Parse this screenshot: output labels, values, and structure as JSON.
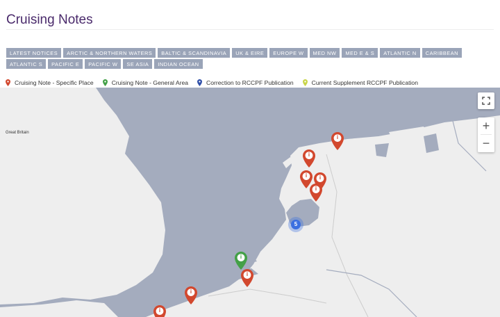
{
  "page": {
    "title": "Cruising Notes"
  },
  "tabs": [
    "LATEST NOTICES",
    "ARCTIC & NORTHERN WATERS",
    "BALTIC & SCANDINAVIA",
    "UK & EIRE",
    "EUROPE W",
    "MED NW",
    "MED E & S",
    "ATLANTIC N",
    "CARIBBEAN",
    "ATLANTIC S",
    "PACIFIC E",
    "PACIFIC W",
    "SE ASIA",
    "INDIAN OCEAN"
  ],
  "legend": [
    {
      "label": "Cruising Note - Specific Place",
      "color": "#d2482e",
      "icon": "map-pin-icon"
    },
    {
      "label": "Cruising Note - General Area",
      "color": "#43a047",
      "icon": "map-pin-icon"
    },
    {
      "label": "Correction to RCCPF Publication",
      "color": "#2f4fa8",
      "icon": "map-pin-icon"
    },
    {
      "label": "Current Supplement RCCPF Publication",
      "color": "#c9d54a",
      "icon": "map-pin-icon"
    }
  ],
  "map": {
    "region_label": "Great Britain",
    "cluster_count": "5",
    "water_color": "#a4acbe",
    "land_color": "#eeeeee",
    "controls": {
      "fullscreen_icon": "fullscreen-icon",
      "zoom_in": "+",
      "zoom_out": "−"
    },
    "marker_glyph": "i",
    "marker_icon": "info-pin-icon"
  }
}
